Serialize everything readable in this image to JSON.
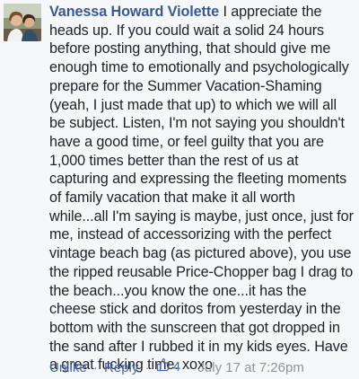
{
  "comment": {
    "author": "Vanessa Howard Violette",
    "text": " I appreciate the heads up. If you could wait a solid 24 hours before posting anything, that should give me enough time to emotionally and psychologically prepare for the Summer Vacation-Shaming (yeah, I just made that up) to which we will all be subject. Listen, I'm not saying you shouldn't have a good time, or feel guilty that you are 1,000 times better than the rest of us at capturing and expressing the fleeting moments of family vacation that make it all worth while...all I'm saying is maybe, just once, just for me, instead of accessorizing with the perfect vintage beach bag (as pictured above), you use the ripped reusable Price-Chopper bag I drag to the beach...you know the one...it has the cheese stick and doritos from yesterday in the bottom with the sunscreen that got dropped in the sand after I rubbed it in my kids eyes. Have a great fucking time. xoxo"
  },
  "actions": {
    "unlike_label": "Unlike",
    "reply_label": "Reply",
    "separator": "·",
    "like_count": "4",
    "timestamp": "July 17 at 7:26pm"
  },
  "icons": {
    "like": "thumbs-up-icon"
  },
  "colors": {
    "author": "#365899",
    "link": "#4267b2",
    "meta": "#90949c",
    "text": "#1d2129",
    "background": "#f6f7f9"
  }
}
